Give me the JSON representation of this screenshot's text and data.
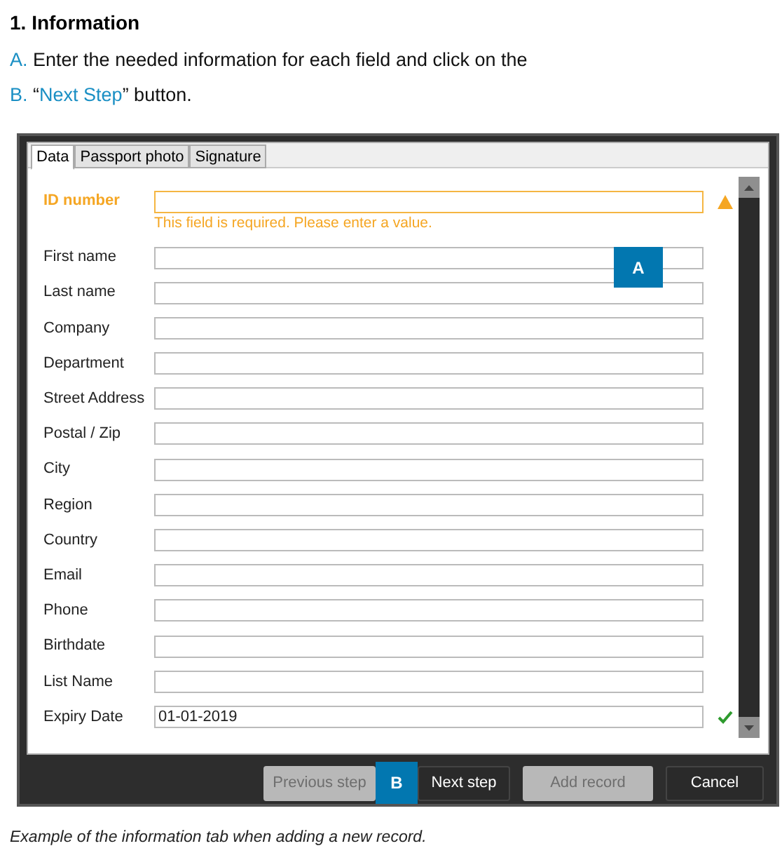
{
  "heading": "1. Information",
  "steps": [
    {
      "marker": "A.",
      "parts": [
        {
          "text": "Enter the needed information for each field and click on the",
          "link": false
        }
      ]
    },
    {
      "marker": "B.",
      "parts": [
        {
          "text": "“",
          "link": false
        },
        {
          "text": "Next Step",
          "link": true
        },
        {
          "text": "” button.",
          "link": false
        }
      ]
    }
  ],
  "dialog": {
    "tabs": [
      {
        "label": "Data",
        "selected": true
      },
      {
        "label": "Passport photo",
        "selected": false
      },
      {
        "label": "Signature",
        "selected": false
      }
    ],
    "fields": [
      {
        "label": "ID number",
        "kind": "error",
        "message": "This field is required. Please enter a value."
      },
      {
        "label": "First name",
        "kind": "normal"
      },
      {
        "label": "Last name",
        "kind": "normal"
      },
      {
        "label": "Company",
        "kind": "normal"
      },
      {
        "label": "Department",
        "kind": "normal"
      },
      {
        "label": "Street Address",
        "kind": "normal"
      },
      {
        "label": "Postal / Zip",
        "kind": "normal"
      },
      {
        "label": "City",
        "kind": "normal"
      },
      {
        "label": "Region",
        "kind": "normal"
      },
      {
        "label": "Country",
        "kind": "normal"
      },
      {
        "label": "Email",
        "kind": "normal"
      },
      {
        "label": "Phone",
        "kind": "normal"
      },
      {
        "label": "Birthdate",
        "kind": "normal"
      },
      {
        "label": "List Name",
        "kind": "normal"
      },
      {
        "label": "Expiry Date",
        "value": "01-01-2019",
        "kind": "valid"
      }
    ],
    "buttons": [
      {
        "label": "Previous step",
        "disabled": true
      },
      {
        "label": "Next step",
        "disabled": false
      },
      {
        "label": "Add record",
        "disabled": true
      },
      {
        "label": "Cancel",
        "disabled": false
      }
    ],
    "callouts": [
      "A",
      "B"
    ]
  },
  "caption": "Example of the information tab when adding a new record."
}
